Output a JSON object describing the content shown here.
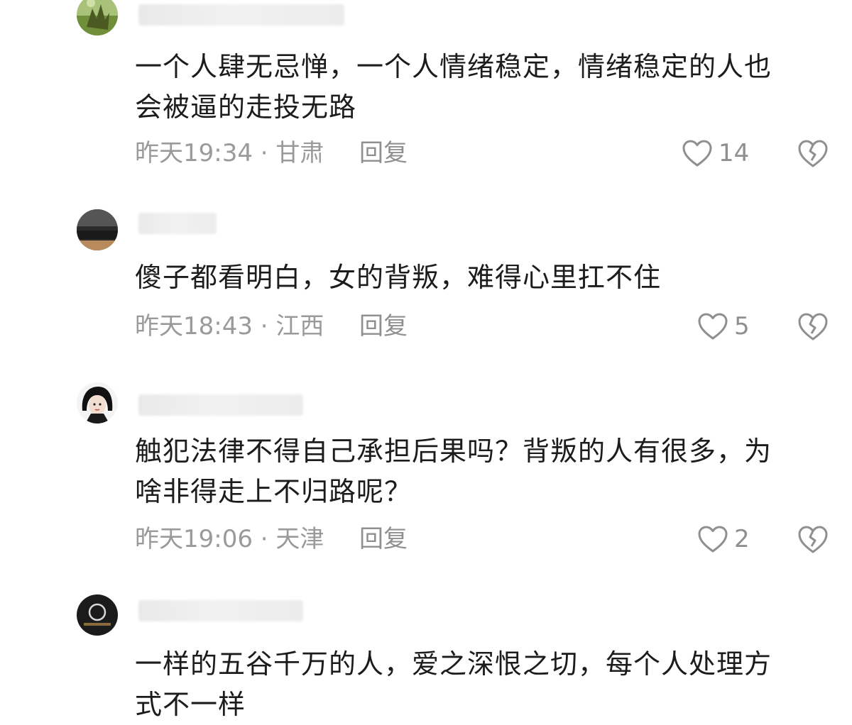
{
  "comments": [
    {
      "text": "一个人肆无忌惮，一个人情绪稳定，情绪稳定的人也\n会被逼的走投无路",
      "time": "昨天19:34",
      "sep": " · ",
      "location": "甘肃",
      "reply_label": "回复",
      "likes": "14"
    },
    {
      "text": "傻子都看明白，女的背叛，难得心里扛不住",
      "time": "昨天18:43",
      "sep": " · ",
      "location": "江西",
      "reply_label": "回复",
      "likes": "5"
    },
    {
      "text": "触犯法律不得自己承担后果吗？背叛的人有很多，为\n啥非得走上不归路呢？",
      "time": "昨天19:06",
      "sep": " · ",
      "location": "天津",
      "reply_label": "回复",
      "likes": "2"
    },
    {
      "text": "一样的五谷千万的人，爱之深恨之切，每个人处理方\n式不一样"
    }
  ],
  "icons": {
    "like": "heart-outline-icon",
    "dislike": "broken-heart-icon"
  },
  "colors": {
    "text": "#1c1c1c",
    "meta": "#9a9a9a",
    "icon": "#8f8f8f"
  }
}
